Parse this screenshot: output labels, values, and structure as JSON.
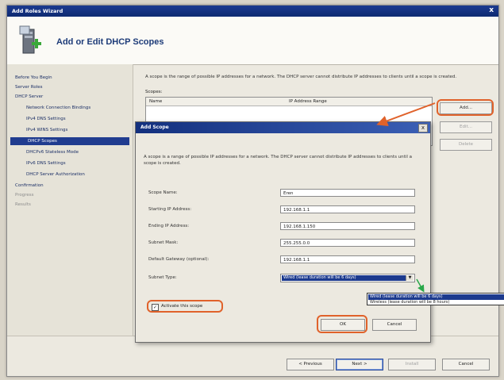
{
  "window": {
    "title": "Add Roles Wizard",
    "close_glyph": "x"
  },
  "header": {
    "title": "Add or Edit DHCP Scopes",
    "icon": "server-role-icon"
  },
  "nav": {
    "items": [
      {
        "label": "Before You Begin",
        "state": "normal"
      },
      {
        "label": "Server Roles",
        "state": "normal"
      },
      {
        "label": "DHCP Server",
        "state": "normal"
      },
      {
        "label": "Network Connection Bindings",
        "state": "normal"
      },
      {
        "label": "IPv4 DNS Settings",
        "state": "normal"
      },
      {
        "label": "IPv4 WINS Settings",
        "state": "normal"
      },
      {
        "label": "DHCP Scopes",
        "state": "selected"
      },
      {
        "label": "DHCPv6 Stateless Mode",
        "state": "normal"
      },
      {
        "label": "IPv6 DNS Settings",
        "state": "normal"
      },
      {
        "label": "DHCP Server Authorization",
        "state": "normal"
      },
      {
        "label": "Confirmation",
        "state": "normal"
      },
      {
        "label": "Progress",
        "state": "disabled"
      },
      {
        "label": "Results",
        "state": "disabled"
      }
    ]
  },
  "main": {
    "description": "A scope is the range of possible IP addresses for a network. The DHCP server cannot distribute IP addresses to clients until a scope is created.",
    "scopes_label": "Scopes:",
    "table_headers": [
      "Name",
      "IP Address Range"
    ],
    "buttons": {
      "add": "Add...",
      "edit": "Edit...",
      "delete": "Delete"
    }
  },
  "footer": {
    "previous": "< Previous",
    "next": "Next >",
    "install": "Install",
    "cancel": "Cancel"
  },
  "dialog": {
    "title": "Add Scope",
    "close_glyph": "x",
    "description": "A scope is a range of possible IP addresses for a network. The DHCP server cannot distribute IP addresses to clients until a scope is created.",
    "fields": {
      "scope_name_label": "Scope Name:",
      "scope_name_value": "Eren",
      "start_ip_label": "Starting IP Address:",
      "start_ip_value": "192.168.1.1",
      "end_ip_label": "Ending IP Address:",
      "end_ip_value": "192.168.1.150",
      "subnet_mask_label": "Subnet Mask:",
      "subnet_mask_value": "255.255.0.0",
      "gateway_label": "Default Gateway (optional):",
      "gateway_value": "192.168.1.1",
      "subnet_type_label": "Subnet Type:",
      "subnet_type_value": "Wired (lease duration will be 6 days)"
    },
    "activate_label": "Activate this scope",
    "activate_checked": "✓",
    "ok": "OK",
    "cancel": "Cancel"
  },
  "dropdown": {
    "options": [
      "Wired (lease duration will be 6 days)",
      "Wireless (lease duration will be 8 hours)"
    ],
    "selected_index": 0
  },
  "colors": {
    "accent": "#e0622b",
    "selection": "#1c3a8e",
    "title_bar": "#13307e"
  }
}
